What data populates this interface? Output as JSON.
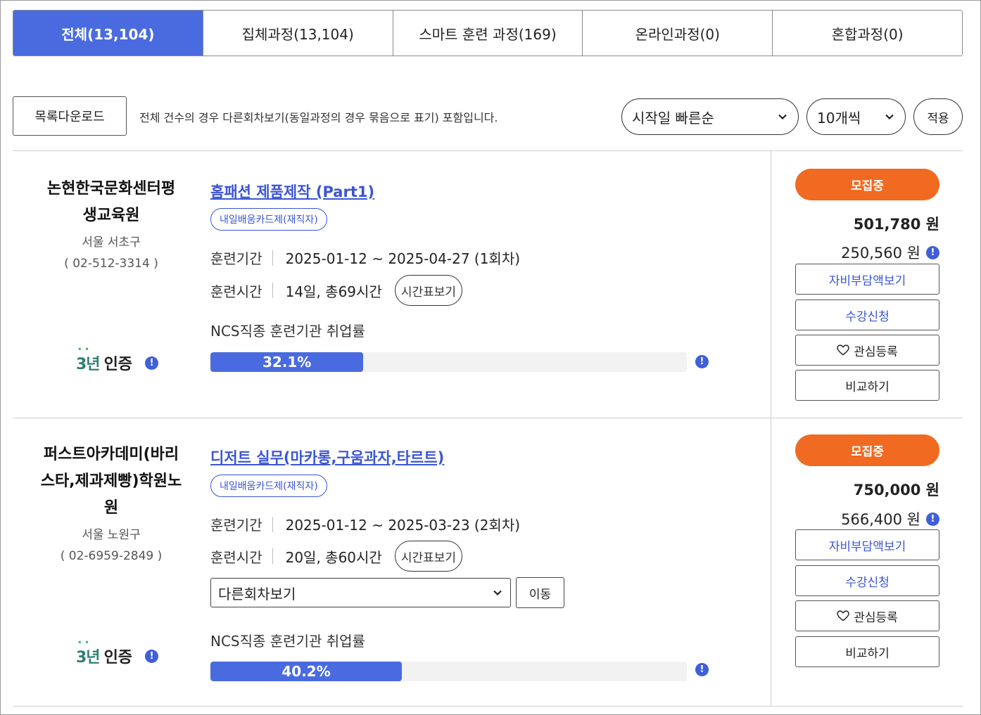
{
  "tabs": [
    {
      "label": "전체(13,104)",
      "active": true
    },
    {
      "label": "집체과정(13,104)",
      "active": false
    },
    {
      "label": "스마트 훈련 과정(169)",
      "active": false
    },
    {
      "label": "온라인과정(0)",
      "active": false
    },
    {
      "label": "혼합과정(0)",
      "active": false
    }
  ],
  "toolbar": {
    "download_label": "목록다운로드",
    "note": "전체 건수의 경우 다른회차보기(동일과정의 경우 묶음으로 표기) 포함입니다.",
    "sort_value": "시작일 빠른순",
    "count_value": "10개씩",
    "apply_label": "적용"
  },
  "courses": [
    {
      "institution": "논현한국문화센터평생교육원",
      "institution_lines": [
        "논현한국문화센터평",
        "생교육원"
      ],
      "region": "서울 서초구",
      "phone": "( 02-512-3314 )",
      "cert": "인증",
      "cert_years": "3년",
      "title": "홈패션 제품제작 (Part1)",
      "badge": "내일배움카드제(재직자)",
      "period_label": "훈련기간",
      "period_value": "2025-01-12 ~ 2025-04-27 (1회차)",
      "time_label": "훈련시간",
      "time_value": "14일, 총69시간",
      "timetable_label": "시간표보기",
      "ncs_label": "NCS직종 훈련기관 취업률",
      "employment_rate": 32.1,
      "employment_rate_text": "32.1%",
      "status": "모집중",
      "price": "501,780 원",
      "self_pay": "250,560 원",
      "self_pay_button": "자비부담액보기",
      "apply_button": "수강신청",
      "fav_button": "관심등록",
      "compare_button": "비교하기"
    },
    {
      "institution": "퍼스트아카데미(바리스타,제과제빵)학원노원",
      "institution_lines": [
        "퍼스트아카데미(바리",
        "스타,제과제빵)학원노",
        "원"
      ],
      "region": "서울 노원구",
      "phone": "( 02-6959-2849 )",
      "cert": "인증",
      "cert_years": "3년",
      "title": "디저트 실무(마카롱,구움과자,타르트)",
      "badge": "내일배움카드제(재직자)",
      "period_label": "훈련기간",
      "period_value": "2025-01-12 ~ 2025-03-23 (2회차)",
      "time_label": "훈련시간",
      "time_value": "20일, 총60시간",
      "timetable_label": "시간표보기",
      "other_round_select": "다른회차보기",
      "move_button": "이동",
      "ncs_label": "NCS직종 훈련기관 취업률",
      "employment_rate": 40.2,
      "employment_rate_text": "40.2%",
      "status": "모집중",
      "price": "750,000 원",
      "self_pay": "566,400 원",
      "self_pay_button": "자비부담액보기",
      "apply_button": "수강신청",
      "fav_button": "관심등록",
      "compare_button": "비교하기"
    }
  ],
  "colors": {
    "accent_blue": "#4a6bdf",
    "link_blue": "#3b55d6",
    "status_orange": "#f06a21",
    "cert_green": "#2f7f77"
  }
}
